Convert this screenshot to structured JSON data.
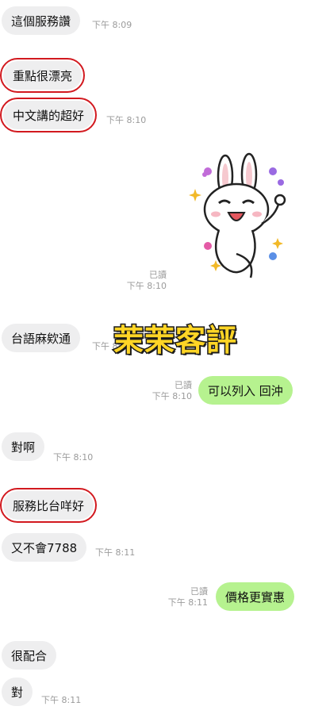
{
  "messages": [
    {
      "id": "m1",
      "text": "這個服務讚",
      "time": "下午 8:09"
    },
    {
      "id": "m2",
      "text": "重點很漂亮"
    },
    {
      "id": "m3",
      "text": "中文講的超好",
      "time": "下午 8:10"
    },
    {
      "id": "sticker",
      "read": "已讀",
      "time": "下午 8:10",
      "icon": "bunny-sticker-icon"
    },
    {
      "id": "m4",
      "text": "台語麻欸通",
      "time": "下午 8:10"
    },
    {
      "id": "m5",
      "text": "可以列入 回沖",
      "read": "已讀",
      "time": "下午 8:10"
    },
    {
      "id": "m6",
      "text": "對啊",
      "time": "下午 8:10"
    },
    {
      "id": "m7",
      "text": "服務比台咩好"
    },
    {
      "id": "m8",
      "text": "又不會7788",
      "time": "下午 8:11"
    },
    {
      "id": "m9",
      "text": "價格更實惠",
      "read": "已讀",
      "time": "下午 8:11"
    },
    {
      "id": "m10",
      "text": "很配合"
    },
    {
      "id": "m11",
      "text": "對",
      "time": "下午 8:11"
    }
  ],
  "watermark": "茉茉客評",
  "colors": {
    "incoming_bubble": "#eeeeef",
    "outgoing_bubble": "#b6f28f",
    "highlight_border": "#d2191f",
    "watermark_fill": "#ffd526",
    "meta_text": "#9b9b9b"
  }
}
